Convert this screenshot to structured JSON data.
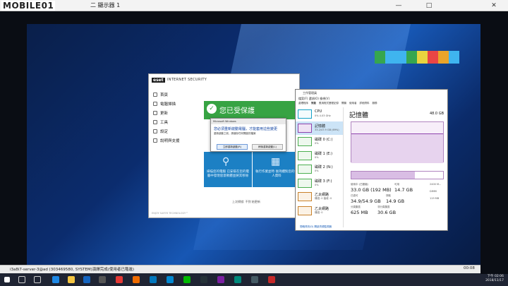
{
  "rdp": {
    "logo": "MOBILE01",
    "title": "二 顯示器 1",
    "minimize": "—",
    "maximize": "□",
    "close": "✕"
  },
  "eset": {
    "logo": "eset",
    "brand": "INTERNET SECURITY",
    "nav": [
      "首頁",
      "電腦掃描",
      "更新",
      "工具",
      "設定",
      "說明與支援"
    ],
    "protected": "您已受保護",
    "card1": "掃描您的電腦 已安裝在您的電腦中發現惡意軟體並將其移除",
    "card2": "執行作業並時 後持續對您的個人資料",
    "links": "上次掃描: 不到 給更新",
    "footer": "ENJOY SAFER TECHNOLOGY™"
  },
  "dialog": {
    "title": "Microsoft Windows",
    "message": "您必須重新啟動電腦，才能套用這些變更",
    "sub": "重新啟動之前，請儲存任何開啟的檔案",
    "restart_now": "立即重新啟動(R)",
    "restart_later": "稍後重新啟動(L)"
  },
  "taskmgr": {
    "title": "工作管理員",
    "menu": "檔案(F)  選項(O)  檢視(V)",
    "tabs": [
      "處理程序",
      "效能",
      "應用程式歷程記錄",
      "開機",
      "使用者",
      "詳細資料",
      "服務"
    ],
    "items": [
      {
        "name": "CPU",
        "sub": "0%  4.03 GHz"
      },
      {
        "name": "記憶體",
        "sub": "33.2/47.9 GB (69%)"
      },
      {
        "name": "磁碟 0 (C:)",
        "sub": "0%"
      },
      {
        "name": "磁碟 1 (E:)",
        "sub": "0%"
      },
      {
        "name": "磁碟 2 (N:)",
        "sub": "0%"
      },
      {
        "name": "磁碟 3 (F:)",
        "sub": "0%"
      },
      {
        "name": "乙太網路",
        "sub": "傳送: 0 接收: 0"
      },
      {
        "name": "乙太網路",
        "sub": "傳送: 0"
      }
    ],
    "heading": "記憶體",
    "capacity": "48.0 GB",
    "in_use_label": "使用中 (已壓縮)",
    "in_use": "33.0 GB (192 MB)",
    "available_label": "可用",
    "available": "14.7 GB",
    "committed_label": "已認可",
    "committed": "34.9/54.9 GB",
    "cached_label": "快取",
    "cached": "14.9 GB",
    "paged_label": "分頁集區",
    "paged": "625 MB",
    "nonpaged_label": "非分頁集區",
    "nonpaged": "30.6 GB",
    "speed": "2400 M...",
    "form": "DIMM",
    "reserved": "119 MB",
    "bottom": "簡略資訊(D)   開啟資源監視器"
  },
  "remote_taskbar": {
    "time": "下午 02:06",
    "date": "2018/11/17"
  },
  "local_status": {
    "text": "i3a8i7-server-3@ad (303469580, SYSTEM)演繹完成(使用者已階進)",
    "counter": "00:08"
  },
  "local_taskbar": {
    "time": "下午 02:06",
    "date": "2018/11/17"
  }
}
